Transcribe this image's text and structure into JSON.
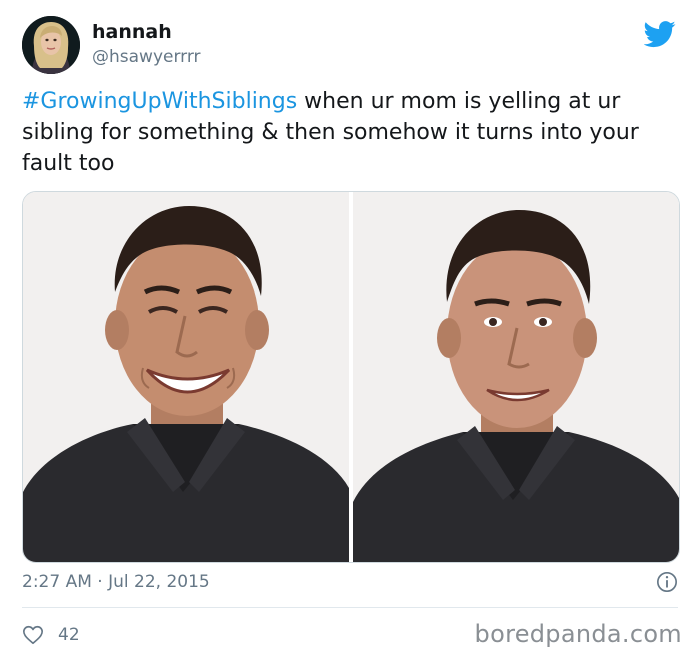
{
  "author": {
    "display_name": "hannah",
    "handle": "@hsawyerrrr",
    "avatar_icon": "profile-photo-avatar"
  },
  "tweet": {
    "hashtag": "#GrowingUpWithSiblings",
    "text": " when ur mom is yelling at ur sibling for something & then somehow it turns into your fault too",
    "timestamp": "2:27 AM · Jul 22, 2015"
  },
  "media": {
    "photos": [
      {
        "description_icon": "smiling-man-photo"
      },
      {
        "description_icon": "smiling-man-photo"
      }
    ]
  },
  "footer": {
    "like_icon": "heart-icon",
    "like_count": "42",
    "info_icon": "info-icon"
  },
  "watermark": "boredpanda.com",
  "colors": {
    "accent": "#1b95e0",
    "twitter_blue": "#1da1f2",
    "secondary_text": "#657786"
  }
}
